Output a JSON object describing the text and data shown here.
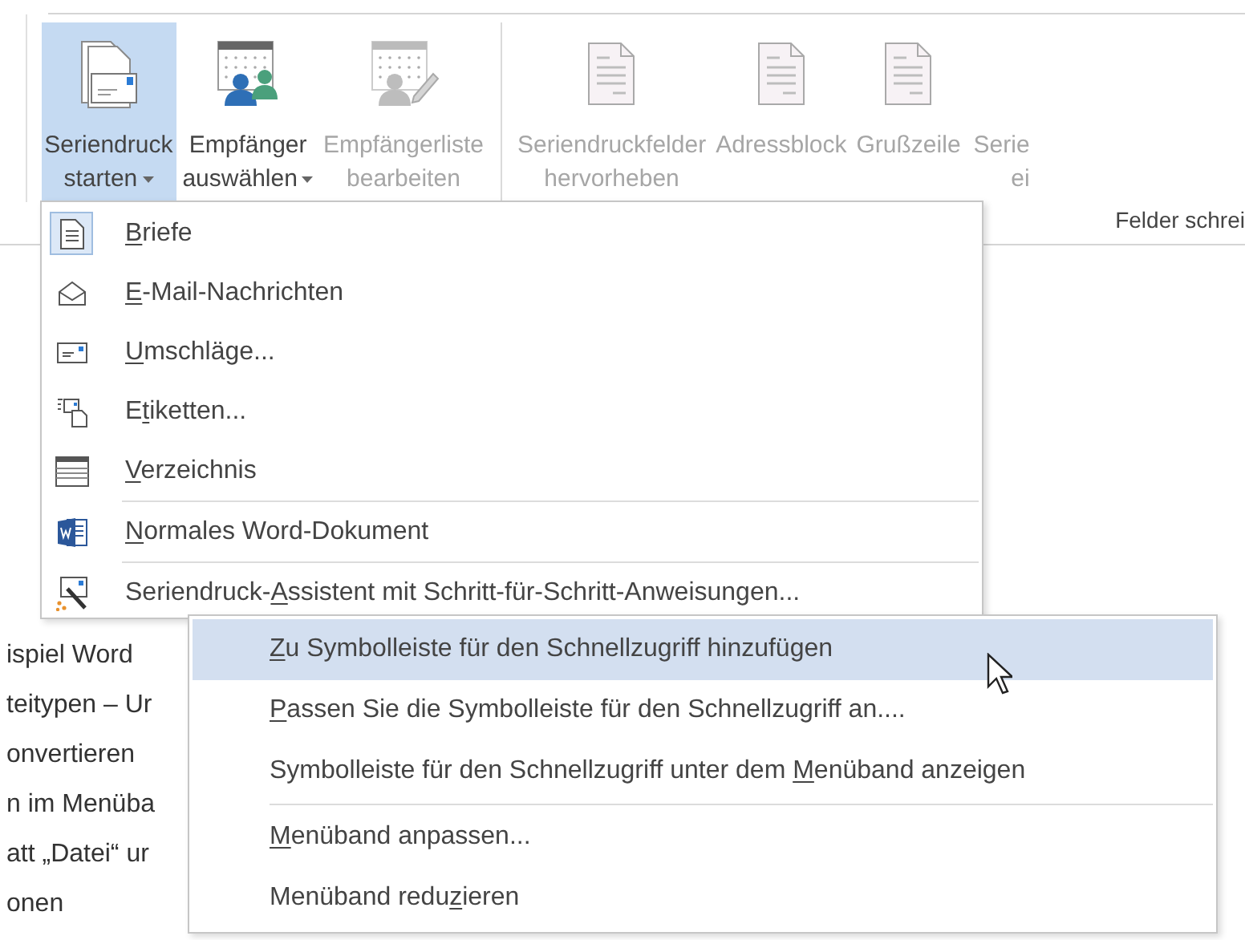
{
  "ribbon": {
    "buttons": [
      {
        "kind": "mailmerge",
        "lines": [
          "Seriendruck",
          "starten"
        ],
        "dropdown": true,
        "selected": true,
        "disabled": false
      },
      {
        "kind": "recipients",
        "lines": [
          "Empfänger",
          "auswählen"
        ],
        "dropdown": true,
        "selected": false,
        "disabled": false
      },
      {
        "kind": "editlist",
        "lines": [
          "Empfängerliste",
          "bearbeiten"
        ],
        "selected": false,
        "disabled": true
      },
      {
        "kind": "highlight",
        "lines": [
          "Seriendruckfelder",
          "hervorheben"
        ],
        "selected": false,
        "disabled": true
      },
      {
        "kind": "address",
        "lines": [
          "Adressblock"
        ],
        "selected": false,
        "disabled": true
      },
      {
        "kind": "greeting",
        "lines": [
          "Grußzeile"
        ],
        "selected": false,
        "disabled": true
      },
      {
        "kind": "insert",
        "lines": [
          "Serie",
          "ei"
        ],
        "selected": false,
        "disabled": true
      }
    ],
    "group_label": "Felder schrei"
  },
  "document_lines": [
    "ispiel Word",
    "teitypen – Ur",
    "onvertieren",
    "n im Menüba",
    "att „Datei“ ur",
    "onen"
  ],
  "dropdown_menu": {
    "items": [
      {
        "kind": "letter",
        "key": "B",
        "post": "riefe",
        "checked": true
      },
      {
        "kind": "email",
        "key": "E",
        "post": "-Mail-Nachrichten",
        "checked": false
      },
      {
        "kind": "envelope",
        "key": "U",
        "post": "mschläge...",
        "checked": false
      },
      {
        "kind": "labels",
        "pre": "E",
        "key": "t",
        "post": "iketten...",
        "checked": false
      },
      {
        "kind": "directory",
        "key": "V",
        "post": "erzeichnis",
        "checked": false
      },
      {
        "kind": "word",
        "key": "N",
        "post": "ormales Word-Dokument",
        "checked": false,
        "separator_before": true
      },
      {
        "kind": "wizard",
        "pre": "Seriendruck-",
        "key": "A",
        "post": "ssistent mit Schritt-für-Schritt-Anweisungen...",
        "checked": false,
        "separator_before": true
      }
    ]
  },
  "context_menu": {
    "items": [
      {
        "key": "Z",
        "post": "u Symbolleiste für den Schnellzugriff hinzufügen",
        "selected": true
      },
      {
        "key": "P",
        "post": "assen Sie die Symbolleiste für den Schnellzugriff an....",
        "selected": false
      },
      {
        "pre": "Symbolleiste für den Schnellzugriff unter dem ",
        "key": "M",
        "post": "enüband anzeigen",
        "selected": false
      },
      {
        "key": "M",
        "post": "enüband anpassen...",
        "selected": false,
        "separator_before": true
      },
      {
        "pre": "Menüband redu",
        "key": "z",
        "post": "ieren",
        "selected": false
      }
    ]
  }
}
